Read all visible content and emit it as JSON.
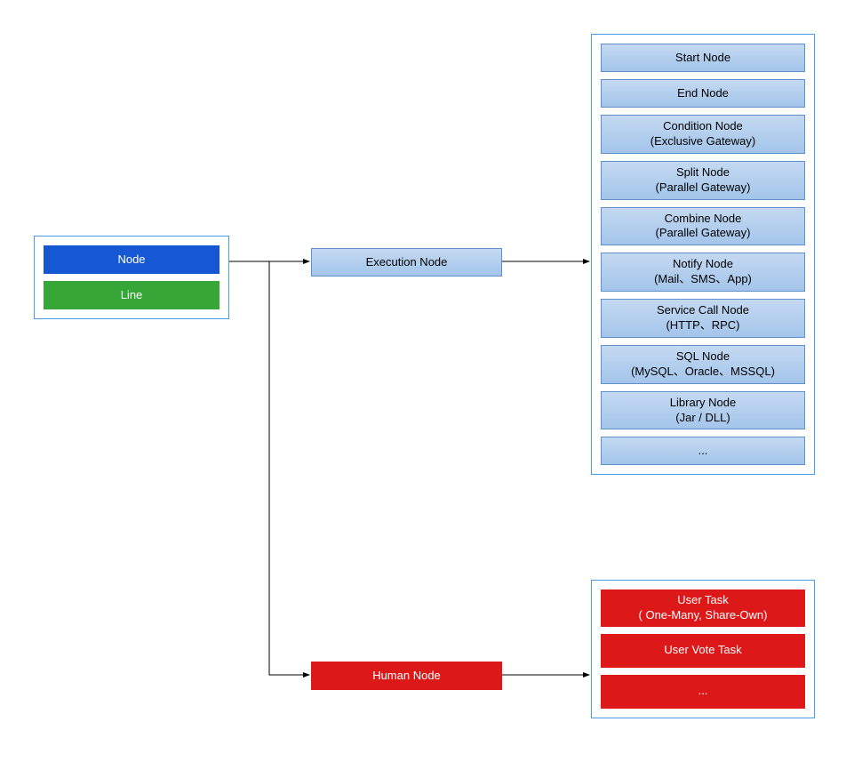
{
  "root": {
    "node": "Node",
    "line": "Line"
  },
  "executionNode": "Execution Node",
  "humanNode": "Human Node",
  "executionChildren": [
    "Start Node",
    "End Node",
    "Condition Node\n(Exclusive Gateway)",
    "Split Node\n(Parallel Gateway)",
    "Combine Node\n(Parallel Gateway)",
    "Notify Node\n(Mail、SMS、App)",
    "Service Call Node\n(HTTP、RPC)",
    "SQL Node\n(MySQL、Oracle、MSSQL)",
    "Library Node\n(Jar / DLL)",
    "..."
  ],
  "humanChildren": [
    "User Task\n( One-Many, Share-Own)",
    "User Vote Task",
    "..."
  ]
}
